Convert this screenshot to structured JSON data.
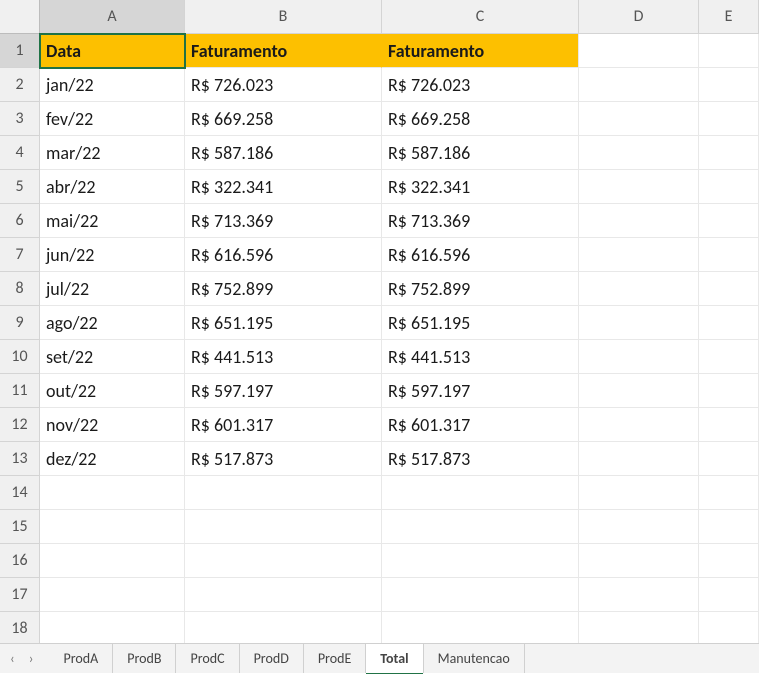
{
  "columns": [
    "A",
    "B",
    "C",
    "D",
    "E"
  ],
  "rowCount": 18,
  "headerRow": {
    "A": "Data",
    "B": "Faturamento",
    "C": "Faturamento"
  },
  "rows": [
    {
      "A": "jan/22",
      "B": "R$ 726.023",
      "C": "R$ 726.023"
    },
    {
      "A": "fev/22",
      "B": "R$ 669.258",
      "C": "R$ 669.258"
    },
    {
      "A": "mar/22",
      "B": "R$ 587.186",
      "C": "R$ 587.186"
    },
    {
      "A": "abr/22",
      "B": "R$ 322.341",
      "C": "R$ 322.341"
    },
    {
      "A": "mai/22",
      "B": "R$ 713.369",
      "C": "R$ 713.369"
    },
    {
      "A": "jun/22",
      "B": "R$ 616.596",
      "C": "R$ 616.596"
    },
    {
      "A": "jul/22",
      "B": "R$ 752.899",
      "C": "R$ 752.899"
    },
    {
      "A": "ago/22",
      "B": "R$ 651.195",
      "C": "R$ 651.195"
    },
    {
      "A": "set/22",
      "B": "R$ 441.513",
      "C": "R$ 441.513"
    },
    {
      "A": "out/22",
      "B": "R$ 597.197",
      "C": "R$ 597.197"
    },
    {
      "A": "nov/22",
      "B": "R$ 601.317",
      "C": "R$ 601.317"
    },
    {
      "A": "dez/22",
      "B": "R$ 517.873",
      "C": "R$ 517.873"
    }
  ],
  "selectedCell": "A1",
  "tabs": [
    "ProdA",
    "ProdB",
    "ProdC",
    "ProdD",
    "ProdE",
    "Total",
    "Manutencao"
  ],
  "activeTab": "Total"
}
